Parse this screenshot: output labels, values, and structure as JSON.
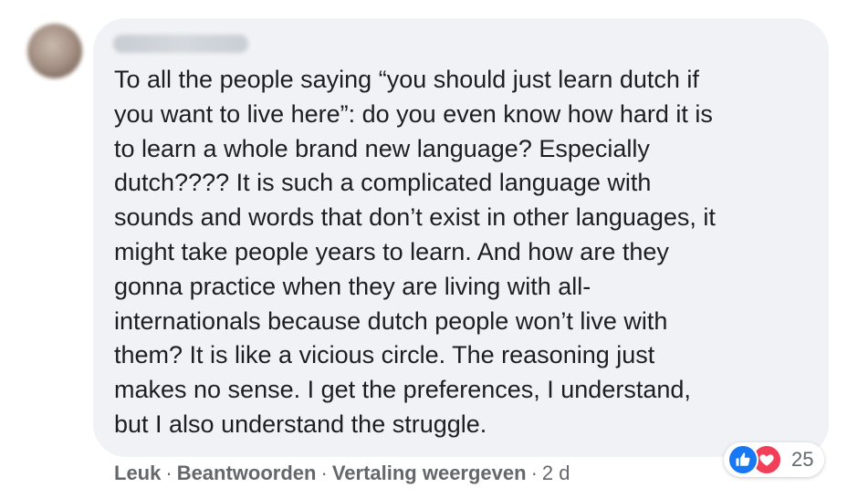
{
  "comment": {
    "lines": [
      "To all the people saying “you should just learn dutch if",
      "you want to live here”: do you even know how hard it is",
      "to learn a whole brand new language? Especially",
      "dutch???? It is such a complicated language with",
      "sounds and words that don’t exist in other languages, it",
      "might take people years to learn. And how are they",
      "gonna practice when they are living with all-",
      "internationals because dutch people won’t live with",
      "them? It is like a vicious circle. The reasoning just",
      "makes no sense. I get the preferences, I understand,",
      "but I also understand the struggle."
    ]
  },
  "actions": {
    "like": "Leuk",
    "reply": "Beantwoorden",
    "translate": "Vertaling weergeven",
    "time": "2 d",
    "separator": "·"
  },
  "reactions": {
    "icons": [
      "thumbs-up-icon",
      "heart-icon"
    ],
    "like_color": "#1877f2",
    "love_color": "#f33e58",
    "count": "25"
  }
}
